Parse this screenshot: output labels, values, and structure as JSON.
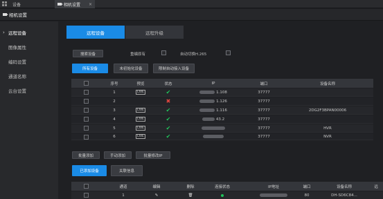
{
  "top_tabs": [
    {
      "label": "设备"
    },
    {
      "label": "相机设置",
      "close": "×"
    }
  ],
  "title": "相机设置",
  "sidebar": {
    "items": [
      {
        "label": "远程设备",
        "active": true
      },
      {
        "label": "图像属性"
      },
      {
        "label": "编码设置"
      },
      {
        "label": "通道名称"
      },
      {
        "label": "云台设置"
      }
    ]
  },
  "main_tabs": [
    {
      "label": "远程设备",
      "active": true
    },
    {
      "label": "远程升级"
    }
  ],
  "search_button": "搜索设备",
  "option1": "重编原有",
  "option2": "自动切换H.265",
  "filter_buttons": [
    {
      "label": "所有设备",
      "active": true
    },
    {
      "label": "未初始化设备"
    },
    {
      "label": "限制自动接入设备"
    }
  ],
  "table": {
    "headers": [
      "序号",
      "预览",
      "状态",
      "IP",
      "端口",
      "设备名称"
    ],
    "rows": [
      {
        "no": "1",
        "live": true,
        "status": "ok",
        "ip": "1.108",
        "port": "37777",
        "name": ""
      },
      {
        "no": "2",
        "live": false,
        "status": "bad",
        "ip": "1.126",
        "port": "37777",
        "name": ""
      },
      {
        "no": "3",
        "live": true,
        "status": "ok",
        "ip": "1.116",
        "port": "37777",
        "name": "2DG2F3BPAN00006"
      },
      {
        "no": "4",
        "live": true,
        "status": "ok",
        "ip": "43.2",
        "port": "37777",
        "name": ""
      },
      {
        "no": "5",
        "live": true,
        "status": "ok",
        "ip": "",
        "port": "37777",
        "name": "HVR"
      },
      {
        "no": "6",
        "live": true,
        "status": "ok",
        "ip": "",
        "port": "37777",
        "name": "NVR"
      }
    ],
    "live_label": "LIVE"
  },
  "action_buttons": [
    "批量添加",
    "手动添加",
    "批量修改IP"
  ],
  "added_tabs": [
    {
      "label": "已添加设备",
      "active": true
    },
    {
      "label": "关联信息"
    }
  ],
  "table2": {
    "headers": [
      "通道",
      "编辑",
      "删除",
      "连接状态",
      "IP地址",
      "端口",
      "设备名称",
      "远"
    ],
    "row": {
      "channel": "1",
      "port": "80",
      "name": "DH-SD6C84..."
    }
  }
}
